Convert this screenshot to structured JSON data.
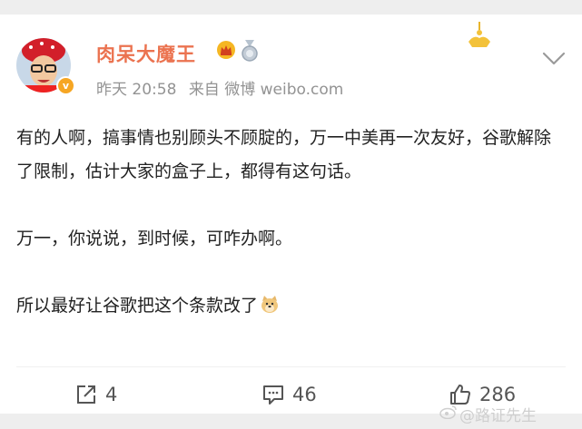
{
  "post": {
    "username": "肉呆大魔王",
    "time": "昨天 20:58",
    "source": "来自 微博 weibo.com",
    "paragraphs": [
      "有的人啊，搞事情也别顾头不顾腚的，万一中美再一次友好，谷歌解除了限制，估计大家的盒子上，都得有这句话。",
      "万一，你说说，到时候，可咋办啊。",
      "所以最好让谷歌把这个条款改了"
    ]
  },
  "actions": {
    "repost_count": "4",
    "comment_count": "46",
    "like_count": "286"
  },
  "watermark": "@路证先生",
  "icons": {
    "avatar": "avatar-photo",
    "verified": "verified-v-badge-icon",
    "crown": "crown-icon",
    "medal": "medal-icon",
    "menu": "chevron-down-icon",
    "emoji": "doge-emoji-icon",
    "repost": "repost-icon",
    "comment": "comment-icon",
    "like": "thumbs-up-icon",
    "watermark_logo": "weibo-logo-icon"
  },
  "colors": {
    "username": "#eb7350",
    "meta": "#939393",
    "text": "#222222",
    "icon": "#555555"
  }
}
